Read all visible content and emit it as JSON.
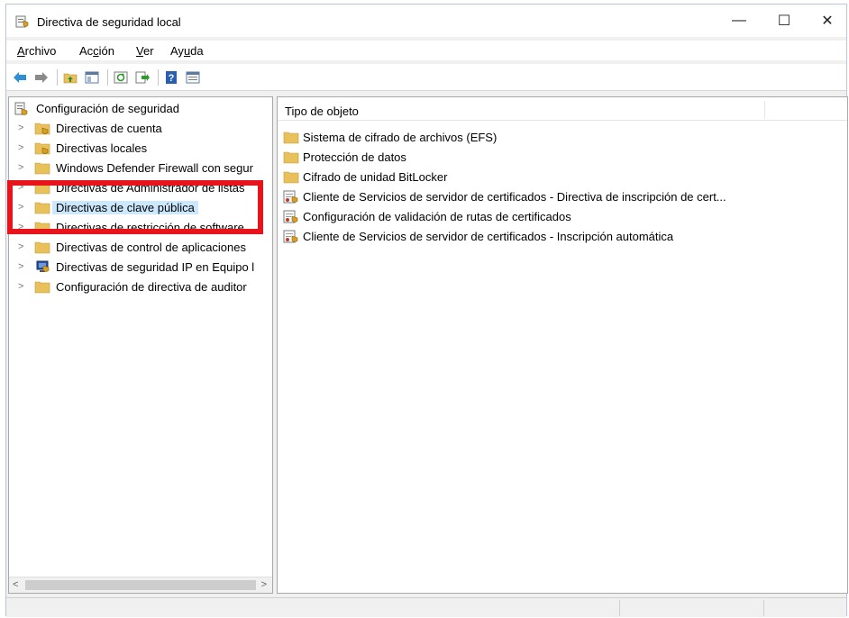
{
  "window": {
    "title": "Directiva de seguridad local",
    "controls": {
      "minimize": "—",
      "maximize": "☐",
      "close": "✕"
    }
  },
  "menu": [
    {
      "pre": "",
      "key": "A",
      "post": "rchivo"
    },
    {
      "pre": "Ac",
      "key": "c",
      "post": "ión"
    },
    {
      "pre": "",
      "key": "V",
      "post": "er"
    },
    {
      "pre": "Ay",
      "key": "u",
      "post": "da"
    }
  ],
  "toolbar": {
    "icons": [
      "back-arrow-icon",
      "forward-arrow-icon",
      "up-folder-icon",
      "show-hide-tree-icon",
      "refresh-icon",
      "export-list-icon",
      "help-icon",
      "properties-icon"
    ]
  },
  "tree": {
    "root": {
      "label": "Configuración de seguridad",
      "icon": "security-settings-icon"
    },
    "items": [
      {
        "label": "Directivas de cuenta",
        "icon": "folder-lock-icon"
      },
      {
        "label": "Directivas locales",
        "icon": "folder-lock-icon"
      },
      {
        "label": "Windows Defender Firewall con segur",
        "icon": "folder-icon"
      },
      {
        "label": "Directivas de Administrador de listas",
        "icon": "folder-icon"
      },
      {
        "label": "Directivas de clave pública",
        "icon": "folder-icon",
        "selected": true
      },
      {
        "label": "Directivas de restricción de software",
        "icon": "folder-icon"
      },
      {
        "label": "Directivas de control de aplicaciones",
        "icon": "folder-icon"
      },
      {
        "label": "Directivas de seguridad IP en Equipo l",
        "icon": "ip-security-icon"
      },
      {
        "label": "Configuración de directiva de auditor",
        "icon": "folder-icon"
      }
    ]
  },
  "list": {
    "column_header": "Tipo de objeto",
    "items": [
      {
        "label": "Sistema de cifrado de archivos (EFS)",
        "icon": "folder-icon"
      },
      {
        "label": "Protección de datos",
        "icon": "folder-icon"
      },
      {
        "label": "Cifrado de unidad BitLocker",
        "icon": "folder-icon"
      },
      {
        "label": "Cliente de Servicios de servidor de certificados - Directiva de inscripción de cert...",
        "icon": "certificate-policy-icon"
      },
      {
        "label": "Configuración de validación de rutas de certificados",
        "icon": "certificate-policy-icon"
      },
      {
        "label": "Cliente de Servicios de servidor de certificados - Inscripción automática",
        "icon": "certificate-policy-icon"
      }
    ]
  },
  "scroll": {
    "left": "<",
    "right": ">"
  },
  "colors": {
    "highlight": "#e8141c",
    "selection": "#cce8ff",
    "folder": "#e8c15a"
  }
}
